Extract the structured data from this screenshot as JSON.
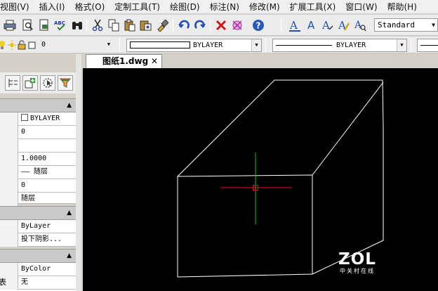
{
  "menu": [
    "视图(V)",
    "插入(I)",
    "格式(O)",
    "定制工具(T)",
    "绘图(D)",
    "标注(N)",
    "修改(M)",
    "扩展工具(X)",
    "窗口(W)",
    "帮助(H)"
  ],
  "toolbar": {
    "text_style": "Standard",
    "abc_label": "ABC"
  },
  "props": {
    "layer_value": "0",
    "color": "BYLAYER",
    "linetype": "BYLAYER"
  },
  "panel": {
    "rows_a": [
      {
        "key": "",
        "value": "BYLAYER"
      },
      {
        "key": "",
        "value": "0"
      },
      {
        "key": "",
        "value": ""
      },
      {
        "key": "",
        "value": "1.0000"
      },
      {
        "key": "",
        "value": "—— 随层"
      },
      {
        "key": "",
        "value": "0"
      },
      {
        "key": "",
        "value": "随层"
      }
    ],
    "rows_b": [
      {
        "key": "",
        "value": "ByLayer"
      },
      {
        "key": "",
        "value": "投下阴影..."
      }
    ],
    "rows_c": [
      {
        "key": "",
        "value": "ByColor"
      },
      {
        "key": "表",
        "value": "无"
      }
    ]
  },
  "tab": {
    "title": "图纸1.dwg",
    "close": "✕"
  },
  "watermark": {
    "brand": "ZOL",
    "tagline": "中关村在线"
  },
  "colors": {
    "canvas": "#000000",
    "lines": "#ffffff",
    "crosshair_x": "#e01010",
    "crosshair_y": "#10c010"
  }
}
